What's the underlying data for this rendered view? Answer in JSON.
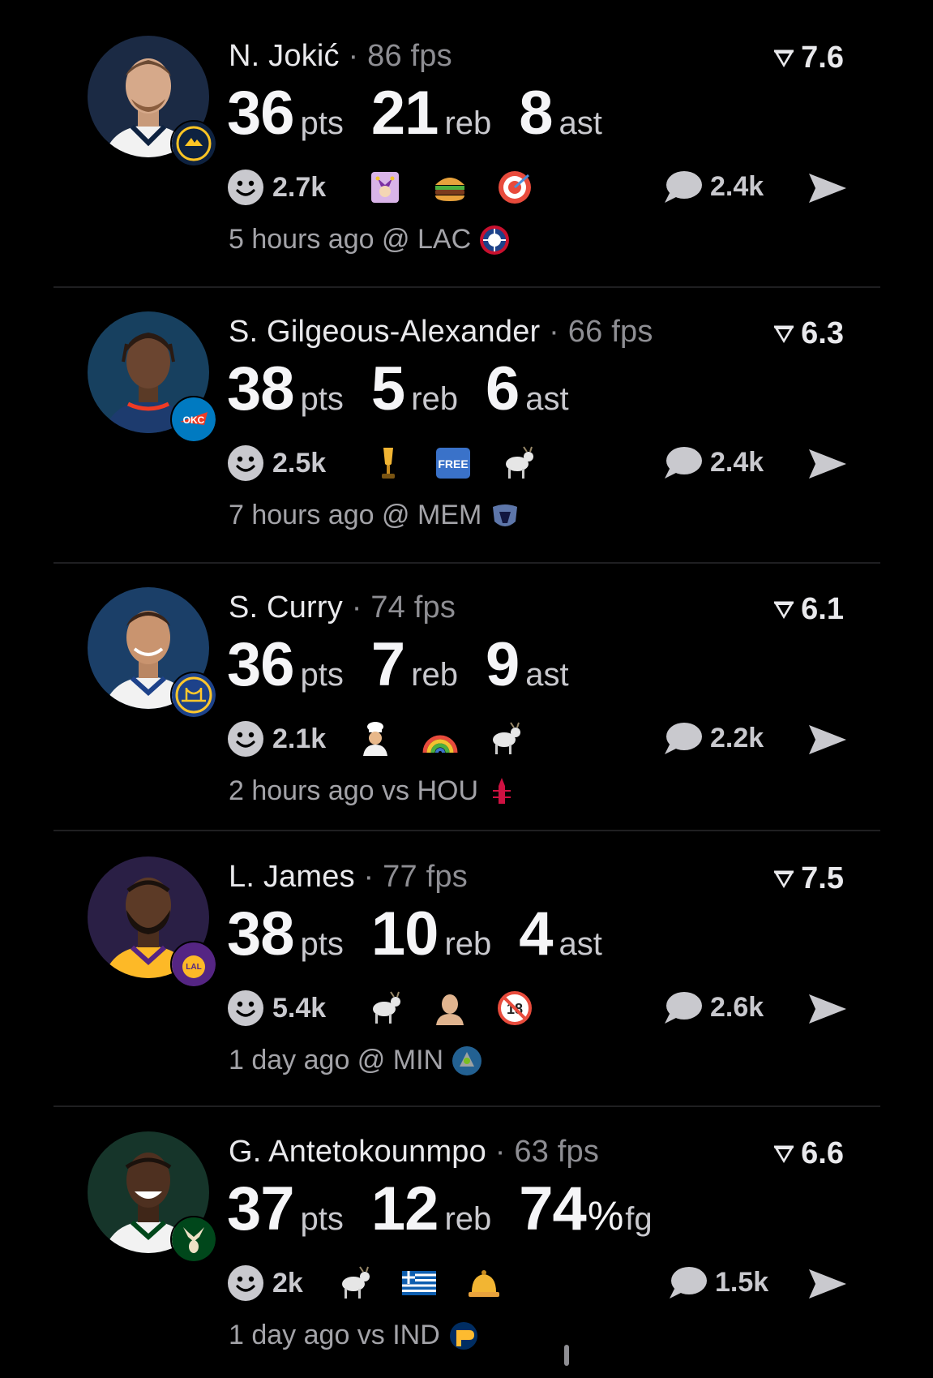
{
  "feed": {
    "posts": [
      {
        "player": "N. Jokić",
        "separator": "·",
        "fps": "86 fps",
        "rating": "7.6",
        "stats": [
          {
            "value": "36",
            "unit": "pts"
          },
          {
            "value": "21",
            "unit": "reb"
          },
          {
            "value": "8",
            "unit": "ast"
          }
        ],
        "reactions": "2.7k",
        "emojis": [
          "jester-emoji",
          "hamburger-emoji",
          "bullseye-emoji"
        ],
        "comments": "2.4k",
        "meta": "5 hours ago @ LAC",
        "opponent_logo": "clippers-logo",
        "team_badge": "nuggets-logo",
        "colors": {
          "avatar_bg": "#1b2a44",
          "jersey": "#f2f2f2",
          "badge": "#0e2240",
          "badge_accent": "#fec524"
        }
      },
      {
        "player": "S. Gilgeous-Alexander",
        "separator": "·",
        "fps": "66 fps",
        "rating": "6.3",
        "stats": [
          {
            "value": "38",
            "unit": "pts"
          },
          {
            "value": "5",
            "unit": "reb"
          },
          {
            "value": "6",
            "unit": "ast"
          }
        ],
        "reactions": "2.5k",
        "emojis": [
          "trophy-emoji",
          "free-button-emoji",
          "goat-emoji"
        ],
        "comments": "2.4k",
        "meta": "7 hours ago @ MEM",
        "opponent_logo": "grizzlies-logo",
        "team_badge": "thunder-logo",
        "colors": {
          "avatar_bg": "#17405f",
          "jersey": "#1d3b6e",
          "badge": "#007ac1",
          "badge_accent": "#ef3b24"
        }
      },
      {
        "player": "S. Curry",
        "separator": "·",
        "fps": "74 fps",
        "rating": "6.1",
        "stats": [
          {
            "value": "36",
            "unit": "pts"
          },
          {
            "value": "7",
            "unit": "reb"
          },
          {
            "value": "9",
            "unit": "ast"
          }
        ],
        "reactions": "2.1k",
        "emojis": [
          "chef-emoji",
          "rainbow-emoji",
          "goat-emoji"
        ],
        "comments": "2.2k",
        "meta": "2 hours ago vs HOU",
        "opponent_logo": "rockets-logo",
        "team_badge": "warriors-logo",
        "colors": {
          "avatar_bg": "#1b3f68",
          "jersey": "#f2f2f2",
          "badge": "#1d428a",
          "badge_accent": "#ffc72c"
        }
      },
      {
        "player": "L. James",
        "separator": "·",
        "fps": "77 fps",
        "rating": "7.5",
        "stats": [
          {
            "value": "38",
            "unit": "pts"
          },
          {
            "value": "10",
            "unit": "reb"
          },
          {
            "value": "4",
            "unit": "ast"
          }
        ],
        "reactions": "5.4k",
        "emojis": [
          "goat-emoji",
          "bald-head-emoji",
          "no-under-18-emoji"
        ],
        "comments": "2.6k",
        "meta": "1 day ago @ MIN",
        "opponent_logo": "timberwolves-logo",
        "team_badge": "lakers-logo",
        "colors": {
          "avatar_bg": "#2a1f45",
          "jersey": "#fdb927",
          "badge": "#552583",
          "badge_accent": "#fdb927"
        }
      },
      {
        "player": "G. Antetokounmpo",
        "separator": "·",
        "fps": "63 fps",
        "rating": "6.6",
        "stats": [
          {
            "value": "37",
            "unit": "pts"
          },
          {
            "value": "12",
            "unit": "reb"
          },
          {
            "value": "74",
            "unit": "%",
            "unit2": "fg"
          }
        ],
        "reactions": "2k",
        "emojis": [
          "goat-emoji",
          "greece-flag-emoji",
          "bell-emoji"
        ],
        "comments": "1.5k",
        "meta": "1 day ago vs IND",
        "opponent_logo": "pacers-logo",
        "team_badge": "bucks-logo",
        "colors": {
          "avatar_bg": "#16352a",
          "jersey": "#f2f2f2",
          "badge": "#00471b",
          "badge_accent": "#eee1c6"
        }
      }
    ]
  }
}
